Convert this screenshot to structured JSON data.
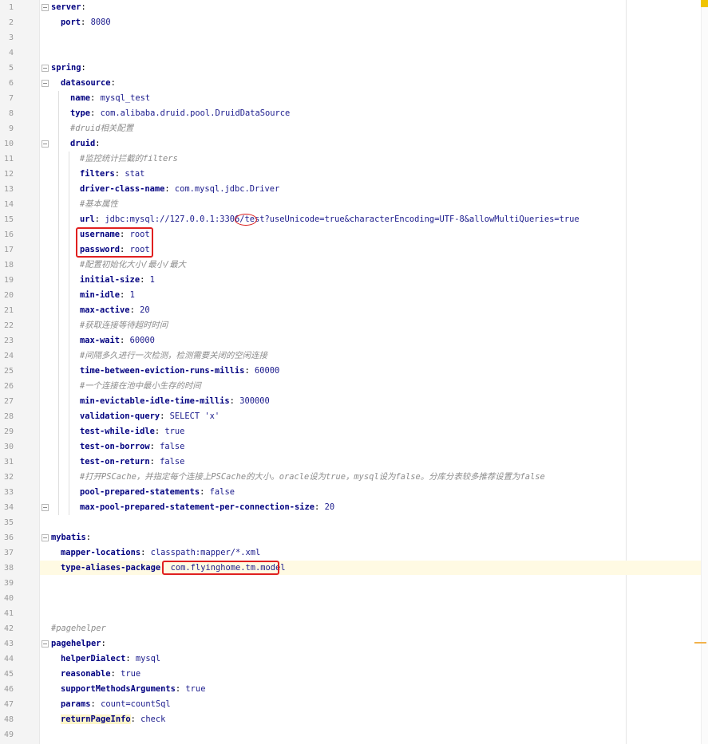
{
  "editor": {
    "lines": [
      {
        "n": "1",
        "key": "server",
        "sep": ":",
        "value": ""
      },
      {
        "n": "2",
        "key": "port",
        "sep": ":",
        "value": "8080"
      },
      {
        "n": "3"
      },
      {
        "n": "4"
      },
      {
        "n": "5",
        "key": "spring",
        "sep": ":",
        "value": ""
      },
      {
        "n": "6",
        "key": "datasource",
        "sep": ":",
        "value": ""
      },
      {
        "n": "7",
        "key": "name",
        "sep": ":",
        "value": "mysql_test"
      },
      {
        "n": "8",
        "key": "type",
        "sep": ":",
        "value": "com.alibaba.druid.pool.DruidDataSource"
      },
      {
        "n": "9",
        "comment": "#druid相关配置"
      },
      {
        "n": "10",
        "key": "druid",
        "sep": ":",
        "value": ""
      },
      {
        "n": "11",
        "comment": "#监控统计拦截的filters"
      },
      {
        "n": "12",
        "key": "filters",
        "sep": ":",
        "value": "stat"
      },
      {
        "n": "13",
        "key": "driver-class-name",
        "sep": ":",
        "value": "com.mysql.jdbc.Driver"
      },
      {
        "n": "14",
        "comment": "#基本属性"
      },
      {
        "n": "15",
        "key": "url",
        "sep": ":",
        "value": "jdbc:mysql://127.0.0.1:3306/test?useUnicode=true&characterEncoding=UTF-8&allowMultiQueries=true"
      },
      {
        "n": "16",
        "key": "username",
        "sep": ":",
        "value": "root"
      },
      {
        "n": "17",
        "key": "password",
        "sep": ":",
        "value": "root"
      },
      {
        "n": "18",
        "comment": "#配置初始化大小/最小/最大"
      },
      {
        "n": "19",
        "key": "initial-size",
        "sep": ":",
        "value": "1"
      },
      {
        "n": "20",
        "key": "min-idle",
        "sep": ":",
        "value": "1"
      },
      {
        "n": "21",
        "key": "max-active",
        "sep": ":",
        "value": "20"
      },
      {
        "n": "22",
        "comment": "#获取连接等待超时时间"
      },
      {
        "n": "23",
        "key": "max-wait",
        "sep": ":",
        "value": "60000"
      },
      {
        "n": "24",
        "comment": "#间隔多久进行一次检测，检测需要关闭的空闲连接"
      },
      {
        "n": "25",
        "key": "time-between-eviction-runs-millis",
        "sep": ":",
        "value": "60000"
      },
      {
        "n": "26",
        "comment": "#一个连接在池中最小生存的时间"
      },
      {
        "n": "27",
        "key": "min-evictable-idle-time-millis",
        "sep": ":",
        "value": "300000"
      },
      {
        "n": "28",
        "key": "validation-query",
        "sep": ":",
        "value": "SELECT 'x'"
      },
      {
        "n": "29",
        "key": "test-while-idle",
        "sep": ":",
        "value": "true"
      },
      {
        "n": "30",
        "key": "test-on-borrow",
        "sep": ":",
        "value": "false"
      },
      {
        "n": "31",
        "key": "test-on-return",
        "sep": ":",
        "value": "false"
      },
      {
        "n": "32",
        "comment": "#打开PSCache，并指定每个连接上PSCache的大小。oracle设为true，mysql设为false。分库分表较多推荐设置为false"
      },
      {
        "n": "33",
        "key": "pool-prepared-statements",
        "sep": ":",
        "value": "false"
      },
      {
        "n": "34",
        "key": "max-pool-prepared-statement-per-connection-size",
        "sep": ":",
        "value": "20"
      },
      {
        "n": "35"
      },
      {
        "n": "36",
        "key": "mybatis",
        "sep": ":",
        "value": ""
      },
      {
        "n": "37",
        "key": "mapper-locations",
        "sep": ":",
        "value": "classpath:mapper/*.xml"
      },
      {
        "n": "38",
        "key": "type-aliases-package",
        "sep": ":",
        "value": "com.flyinghome.tm.model"
      },
      {
        "n": "39"
      },
      {
        "n": "40"
      },
      {
        "n": "41"
      },
      {
        "n": "42",
        "comment": "#pagehelper"
      },
      {
        "n": "43",
        "key": "pagehelper",
        "sep": ":",
        "value": ""
      },
      {
        "n": "44",
        "key": "helperDialect",
        "sep": ":",
        "value": "mysql"
      },
      {
        "n": "45",
        "key": "reasonable",
        "sep": ":",
        "value": "true"
      },
      {
        "n": "46",
        "key": "supportMethodsArguments",
        "sep": ":",
        "value": "true"
      },
      {
        "n": "47",
        "key": "params",
        "sep": ":",
        "value": "count=countSql"
      },
      {
        "n": "48",
        "key": "returnPageInfo",
        "sep": ":",
        "value": "check"
      },
      {
        "n": "49"
      }
    ]
  },
  "colors": {
    "key": "#000080",
    "value": "#1a1a8c",
    "comment": "#8c8c8c",
    "annotation": "#e02020",
    "current_line": "#fffae3"
  }
}
